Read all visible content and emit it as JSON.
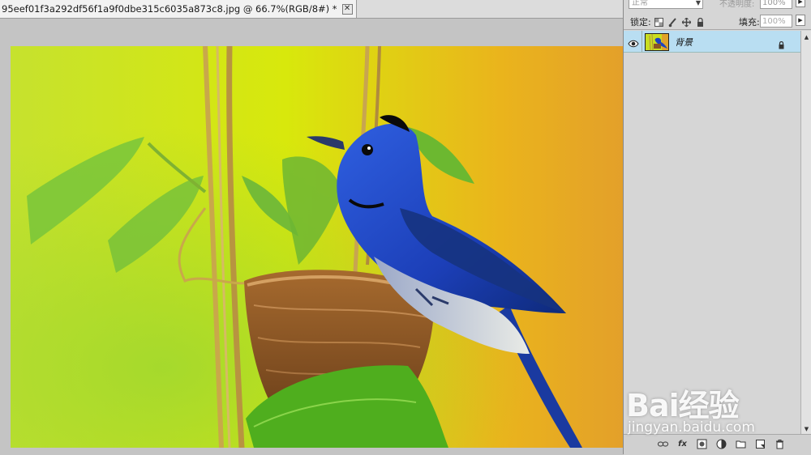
{
  "document": {
    "tab_title": "95eef01f3a292df56f1a9f0dbe315c6035a873c8.jpg @ 66.7%(RGB/8#) *",
    "close_glyph": "✕"
  },
  "layers_panel": {
    "blend_mode": "正常",
    "opacity_label": "不透明度:",
    "opacity_value": "100%",
    "lock_label": "锁定:",
    "fill_label": "填充:",
    "fill_value": "100%",
    "layers": [
      {
        "name": "背景",
        "visible": true,
        "locked": true,
        "selected": true
      }
    ],
    "bottom_icons": [
      "link-icon",
      "fx-icon",
      "mask-icon",
      "adjustment-icon",
      "group-icon",
      "new-layer-icon",
      "trash-icon"
    ]
  },
  "watermark": {
    "brand": "Bai经验",
    "url": "jingyan.baidu.com"
  },
  "colors": {
    "selected_layer": "#b9def2",
    "panel_bg": "#d6d6d6",
    "workspace_bg": "#c4c4c4"
  }
}
